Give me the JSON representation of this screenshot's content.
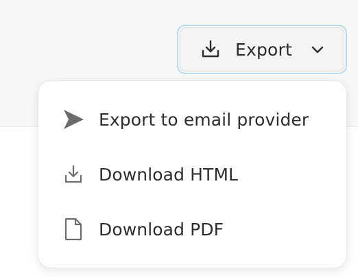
{
  "toolbar": {
    "export_button": {
      "label": "Export",
      "icon": "download-icon",
      "trailing_icon": "chevron-down-icon"
    }
  },
  "export_menu": {
    "items": [
      {
        "label": "Export to email provider",
        "icon": "send-icon"
      },
      {
        "label": "Download HTML",
        "icon": "download-icon"
      },
      {
        "label": "Download PDF",
        "icon": "file-icon"
      }
    ]
  },
  "colors": {
    "focus_ring": "#b7dce8",
    "page_background": "#f7f7f7",
    "menu_background": "#ffffff",
    "text": "#2d2d2d"
  }
}
